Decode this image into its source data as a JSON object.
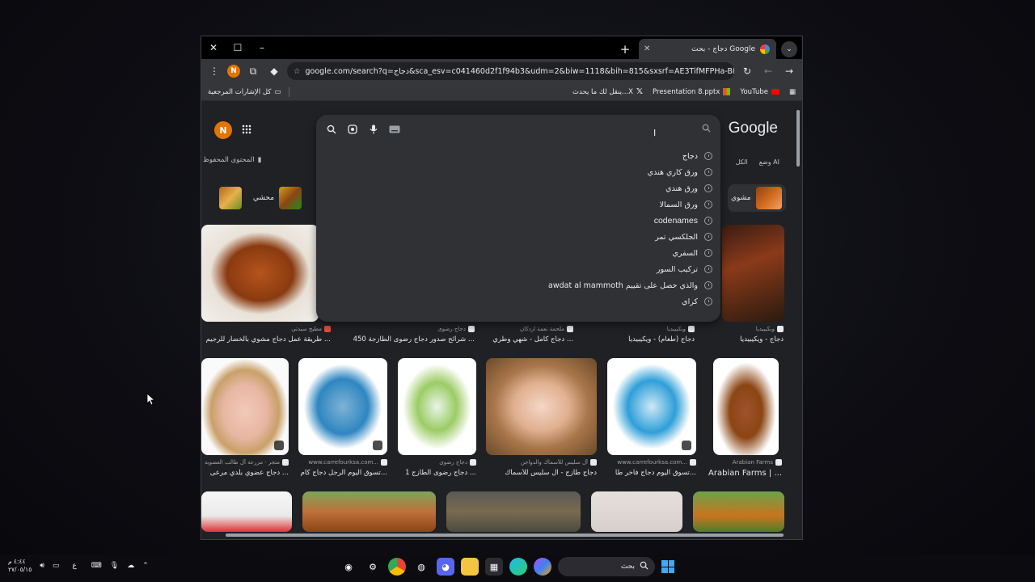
{
  "window": {
    "tab_title": "دجاج - بحث Google",
    "url": "google.com/search?q=دجاج&sca_esv=c041460d2f1f94b3&udm=2&biw=1118&bih=815&sxsrf=AE3TifMFPHa-BhYKuw..."
  },
  "bookmarks": {
    "all_bookmarks": "كل الإشارات المرجعية",
    "items": [
      "YouTube",
      "Presentation 8.pptx",
      "ينقل لك ما يحدث...X"
    ]
  },
  "header": {
    "logo": "Google",
    "avatar_letter": "N",
    "saved": "المحتوى المحفوظ",
    "filters_right": [
      "الكل",
      "وضع AI"
    ]
  },
  "chips": [
    {
      "label": "مشوي"
    },
    {
      "label": "محشي"
    }
  ],
  "search": {
    "value": "",
    "suggestions": [
      "دجاج",
      "ورق كاري هندي",
      "ورق هندي",
      "ورق السمالا",
      "codenames",
      "الجلكسي تمر",
      "السفري",
      "تركيب السور",
      "awdat al mammoth والذي حصل على تقييم",
      "كراي"
    ]
  },
  "row1": [
    {
      "caption": "طريقة عمل دجاج مشوي بالخضار للرجيم ...",
      "source": "مطبخ سيدتي"
    },
    {
      "caption": "شرائح صدور دجاج رضوى الطازجة 450 ...",
      "source": "دجاج رضوى"
    },
    {
      "caption": "دجاج كامل - شهي وطري ...",
      "source": "ملحمة نعمة اردكان"
    },
    {
      "caption": "دجاج (طعام) - ويكيبيديا",
      "source": "ويكيبيديا"
    },
    {
      "caption": "دجاج - ويكيبيديا",
      "source": "ويكيبيديا"
    }
  ],
  "row2": [
    {
      "caption": "دجاج عضوي بلدي مرعى ...",
      "source": "متجر · مزرعة آل طالب العضوية"
    },
    {
      "caption": "تسوق اليوم الرجل دجاج كام...",
      "source": "www.carrefourksa.com..."
    },
    {
      "caption": "دجاج رضوى الطازج 1 ...",
      "source": "دجاج رضوى"
    },
    {
      "caption": "دجاج طازج - آل سليس للأسماك",
      "source": "آل سليس للأسماك والدواجن"
    },
    {
      "caption": "تسوق اليوم دجاج فاخر طا...",
      "source": "www.carrefourksa.com..."
    },
    {
      "caption": "Arabian Farms | ...",
      "source": "Arabian Farms"
    }
  ],
  "taskbar": {
    "search_label": "بحث",
    "time": "٤:٤٤ م",
    "date": "٢٧/٠٥/١٥",
    "lang": "ع"
  }
}
